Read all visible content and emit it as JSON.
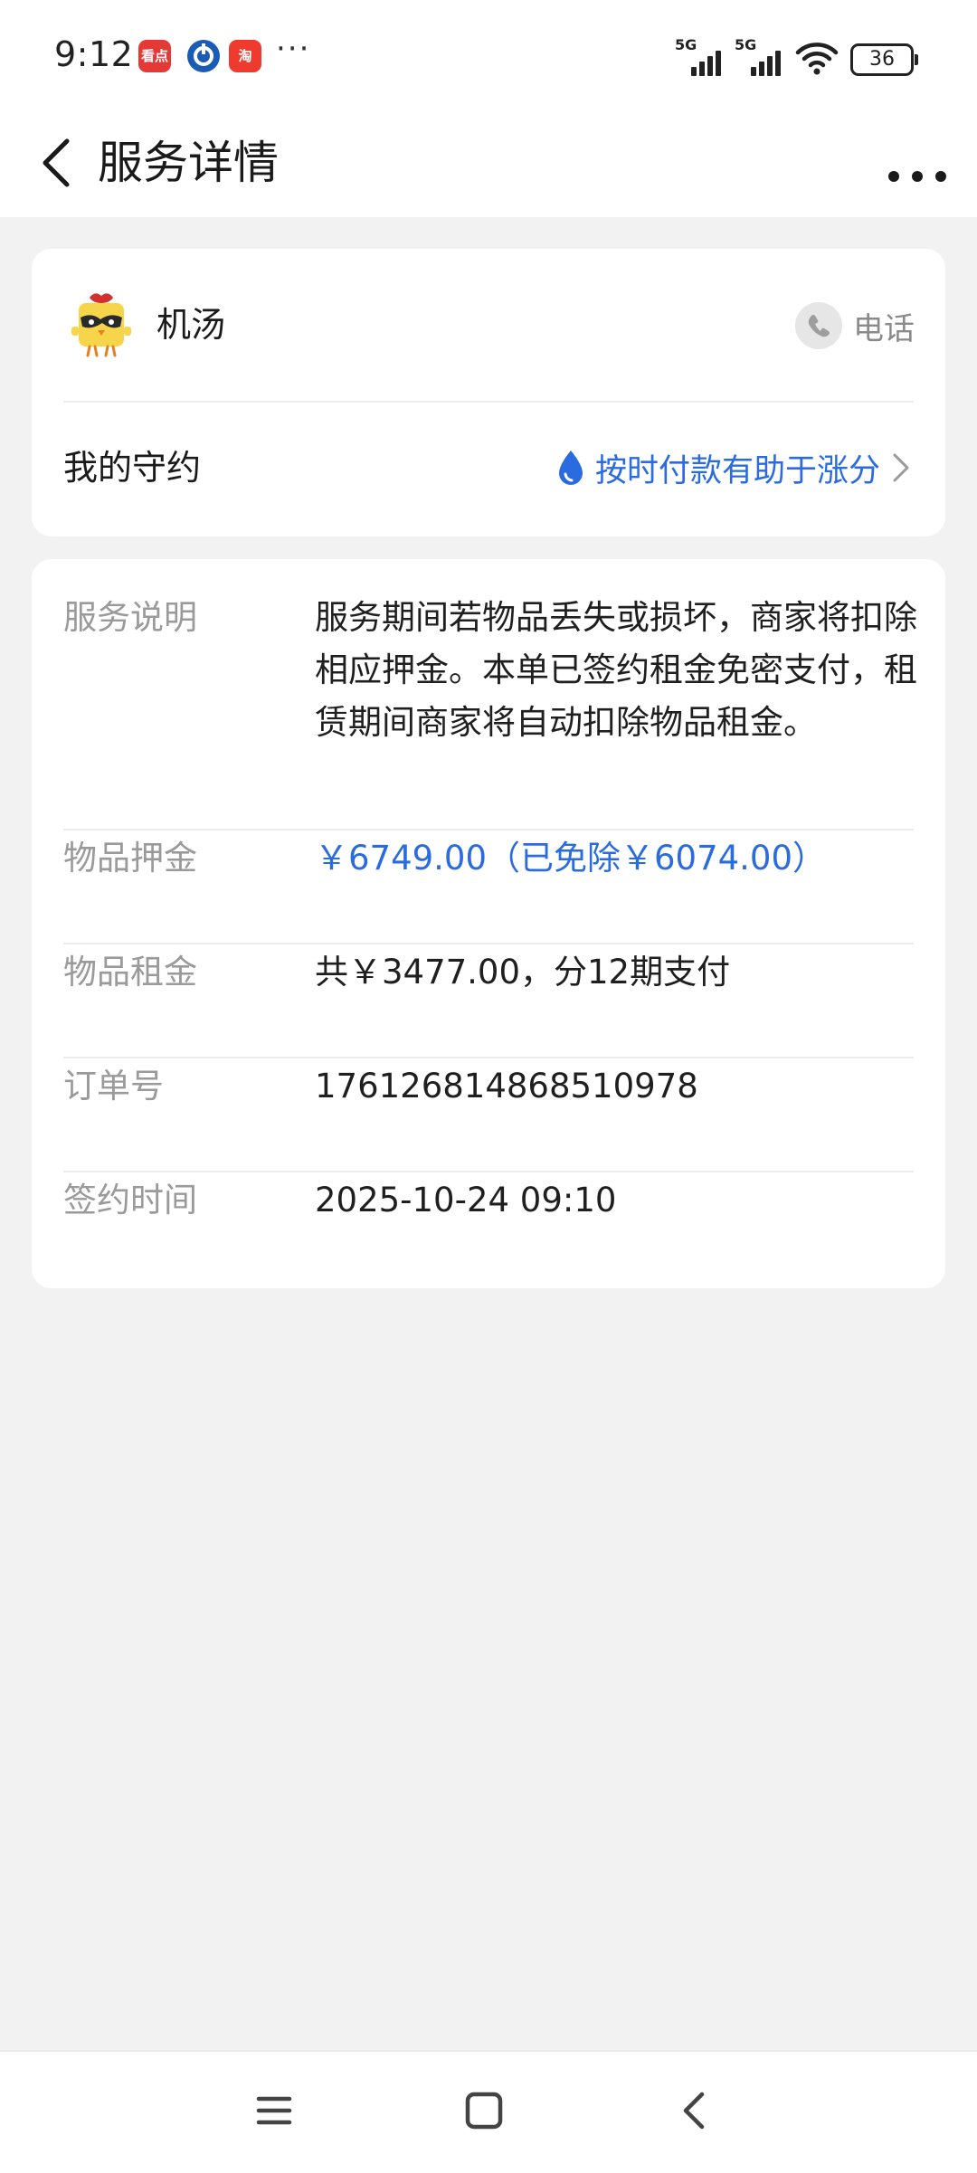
{
  "status_bar": {
    "time": "9:12",
    "battery": "36",
    "signal_1": "5G",
    "signal_2": "5G",
    "more": "···",
    "app_icons": [
      "kandian-app-icon",
      "ccb-app-icon",
      "taobao-app-icon"
    ],
    "app_icon_glyphs": {
      "kandian": "看点",
      "taobao": "淘"
    }
  },
  "header": {
    "title": "服务详情",
    "back_icon": "chevron-left-icon",
    "more_icon": "more-horizontal-icon"
  },
  "merchant": {
    "name": "机汤",
    "avatar_icon": "chick-mascot-icon",
    "phone_label": "电话",
    "phone_icon": "phone-icon"
  },
  "promise": {
    "label": "我的守约",
    "link_text": "按时付款有助于涨分",
    "link_icon": "water-drop-icon",
    "arrow_icon": "chevron-right-icon"
  },
  "details": {
    "description": {
      "key": "服务说明",
      "value": "服务期间若物品丢失或损坏，商家将扣除相应押金。本单已签约租金免密支付，租赁期间商家将自动扣除物品租金。"
    },
    "deposit": {
      "key": "物品押金",
      "value": "￥6749.00（已免除￥6074.00）"
    },
    "rent": {
      "key": "物品租金",
      "value": "共￥3477.00，分12期支付"
    },
    "order": {
      "key": "订单号",
      "value": "1761268148685109 78"
    },
    "signed_time": {
      "key": "签约时间",
      "value": "2025-10-24 09:10"
    }
  },
  "nav_bar": {
    "menu_icon": "menu-icon",
    "home_icon": "home-square-icon",
    "back_icon": "back-triangle-icon"
  },
  "colors": {
    "accent_blue": "#2b6be0",
    "background": "#f2f2f2",
    "card": "#ffffff",
    "secondary_text": "#9a9a9a"
  }
}
